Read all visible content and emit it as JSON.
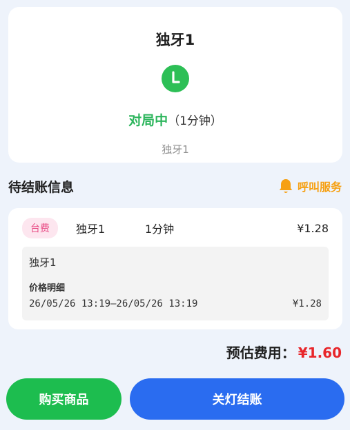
{
  "table": {
    "title": "独牙1",
    "status": "对局中",
    "duration": "（1分钟）",
    "subtitle": "独牙1",
    "status_icon": "clock-icon",
    "status_color": "#2cb55c"
  },
  "section": {
    "title": "待结账信息",
    "call_service_label": "呼叫服务",
    "call_service_icon": "bell-icon",
    "call_service_color": "#f6a012"
  },
  "bill": {
    "tag": "台费",
    "name": "独牙1",
    "duration": "1分钟",
    "amount": "¥1.28",
    "detail": {
      "name": "独牙1",
      "label": "价格明细",
      "range": "26/05/26 13:19—26/05/26 13:19",
      "amount": "¥1.28"
    }
  },
  "estimate": {
    "label": "预估费用：",
    "value": "¥1.60",
    "value_color": "#e8252a"
  },
  "buttons": {
    "buy_label": "购买商品",
    "buy_color": "#1dbd4f",
    "checkout_label": "关灯结账",
    "checkout_color": "#2a6cf0"
  }
}
